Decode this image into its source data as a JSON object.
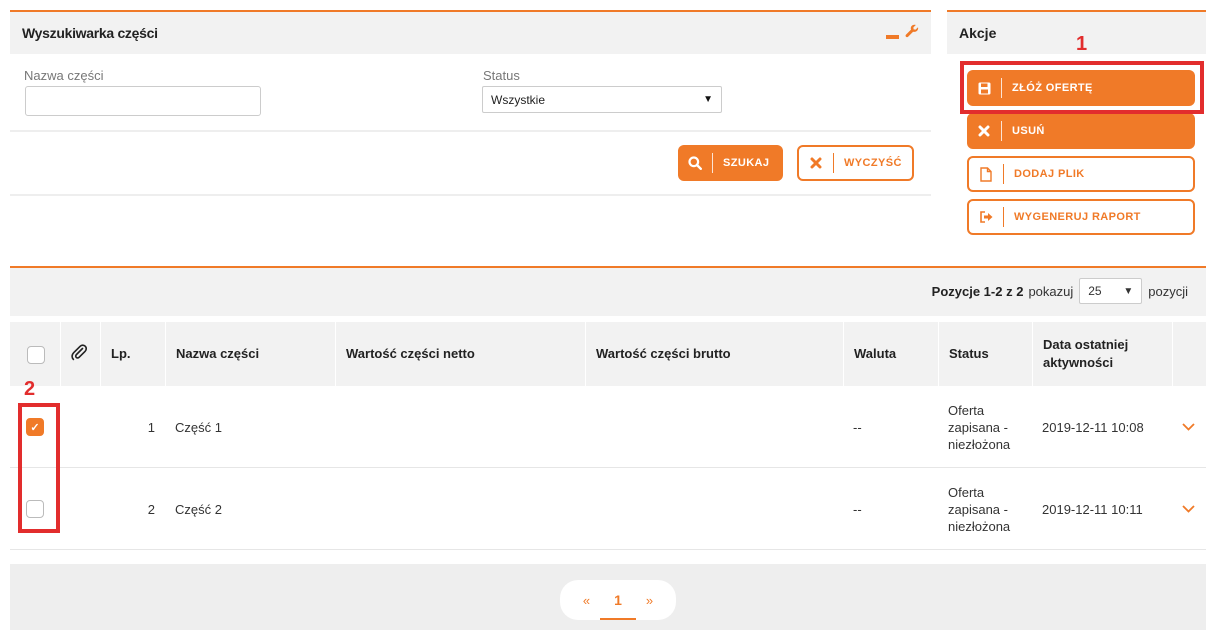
{
  "search": {
    "title": "Wyszukiwarka części",
    "part_name_label": "Nazwa części",
    "part_name_value": "",
    "status_label": "Status",
    "status_value": "Wszystkie",
    "search_button": "SZUKAJ",
    "clear_button": "WYCZYŚĆ"
  },
  "actions": {
    "title": "Akcje",
    "submit_offer": "ZŁÓŻ OFERTĘ",
    "delete": "USUŃ",
    "add_file": "DODAJ PLIK",
    "generate_report": "WYGENERUJ RAPORT"
  },
  "annotations": {
    "marker1": "1",
    "marker2": "2"
  },
  "grid": {
    "paging": {
      "range": "Pozycje 1-2 z 2",
      "show": "pokazuj",
      "page_size": "25",
      "items": "pozycji"
    },
    "columns": {
      "lp": "Lp.",
      "name": "Nazwa części",
      "net": "Wartość części netto",
      "gross": "Wartość części brutto",
      "currency": "Waluta",
      "status": "Status",
      "last_activity": "Data ostatniej aktywności"
    },
    "rows": [
      {
        "lp": "1",
        "name": "Część 1",
        "net": "",
        "gross": "",
        "currency": "--",
        "status": "Oferta zapisana - niezłożona",
        "date": "2019-12-11 10:08",
        "checked": true
      },
      {
        "lp": "2",
        "name": "Część 2",
        "net": "",
        "gross": "",
        "currency": "--",
        "status": "Oferta zapisana - niezłożona",
        "date": "2019-12-11 10:11",
        "checked": false
      }
    ],
    "pager": {
      "prev": "«",
      "current": "1",
      "next": "»"
    }
  },
  "colors": {
    "accent": "#f07a28",
    "highlight": "#e22d2d",
    "panel_bg": "#f2f2f2"
  },
  "icons": {
    "minimize": "minimize-icon",
    "settings": "wrench-icon",
    "search": "search-icon",
    "clear": "x-icon",
    "save": "floppy-icon",
    "delete": "x-icon",
    "file": "file-icon",
    "export": "export-icon",
    "attachment": "paperclip-icon",
    "expand": "chevron-down-icon"
  }
}
